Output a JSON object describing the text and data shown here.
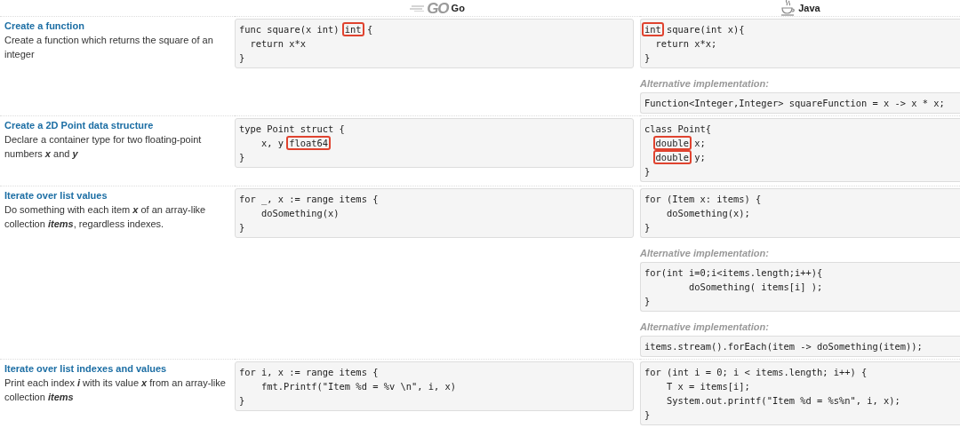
{
  "columns": [
    {
      "kind": "go",
      "logo_text": "GO",
      "label": "Go"
    },
    {
      "kind": "java",
      "label": "Java"
    }
  ],
  "rows": [
    {
      "title": "Create a function",
      "description": "Create a function which returns the square of an integer",
      "go": [
        {
          "lines": [
            [
              {
                "text": "func square(x int) ",
                "highlight": false
              },
              {
                "text": "int",
                "highlight": true
              },
              {
                "text": " {",
                "highlight": false
              }
            ],
            [
              {
                "text": "  return x*x",
                "highlight": false
              }
            ],
            [
              {
                "text": "}",
                "highlight": false
              }
            ]
          ]
        }
      ],
      "java": [
        {
          "lines": [
            [
              {
                "text": "int",
                "highlight": true
              },
              {
                "text": " square(int x){",
                "highlight": false
              }
            ],
            [
              {
                "text": "  return x*x;",
                "highlight": false
              }
            ],
            [
              {
                "text": "}",
                "highlight": false
              }
            ]
          ]
        },
        {
          "alt_label": "Alternative implementation:",
          "lines": [
            [
              {
                "text": "Function<Integer,Integer> squareFunction = x -> x * x;",
                "highlight": false
              }
            ]
          ]
        }
      ]
    },
    {
      "title": "Create a 2D Point data structure",
      "description": "Declare a container type for two floating-point numbers **x** and **y**",
      "go": [
        {
          "lines": [
            [
              {
                "text": "type Point struct {",
                "highlight": false
              }
            ],
            [
              {
                "text": "    x, y ",
                "highlight": false
              },
              {
                "text": "float64",
                "highlight": true
              }
            ],
            [
              {
                "text": "}",
                "highlight": false
              }
            ]
          ]
        }
      ],
      "java": [
        {
          "lines": [
            [
              {
                "text": "class Point{",
                "highlight": false
              }
            ],
            {
              "indented": true,
              "segments": [
                {
                  "text": "double",
                  "highlight": true
                },
                {
                  "text": " x;",
                  "highlight": false
                }
              ]
            },
            {
              "indented": true,
              "segments": [
                {
                  "text": "double",
                  "highlight": true
                },
                {
                  "text": " y;",
                  "highlight": false
                }
              ]
            },
            [
              {
                "text": "}",
                "highlight": false
              }
            ]
          ]
        }
      ]
    },
    {
      "title": "Iterate over list values",
      "description": "Do something with each item **x** of an array-like collection **items**, regardless indexes.",
      "go": [
        {
          "lines": [
            [
              {
                "text": "for _, x := range items {",
                "highlight": false
              }
            ],
            [
              {
                "text": "    doSomething(x)",
                "highlight": false
              }
            ],
            [
              {
                "text": "}",
                "highlight": false
              }
            ]
          ]
        }
      ],
      "java": [
        {
          "lines": [
            [
              {
                "text": "for (Item x: items) {",
                "highlight": false
              }
            ],
            [
              {
                "text": "    doSomething(x);",
                "highlight": false
              }
            ],
            [
              {
                "text": "}",
                "highlight": false
              }
            ]
          ]
        },
        {
          "alt_label": "Alternative implementation:",
          "lines": [
            [
              {
                "text": "for(int i=0;i<items.length;i++){",
                "highlight": false
              }
            ],
            [
              {
                "text": "        doSomething( items[i] );",
                "highlight": false
              }
            ],
            [
              {
                "text": "}",
                "highlight": false
              }
            ]
          ]
        },
        {
          "alt_label": "Alternative implementation:",
          "lines": [
            [
              {
                "text": "items.stream().forEach(item -> doSomething(item));",
                "highlight": false
              }
            ]
          ]
        }
      ]
    },
    {
      "title": "Iterate over list indexes and values",
      "description": "Print each index **i** with its value **x** from an array-like collection **items**",
      "go": [
        {
          "lines": [
            [
              {
                "text": "for i, x := range items {",
                "highlight": false
              }
            ],
            [
              {
                "text": "    fmt.Printf(\"Item %d = %v \\n\", i, x)",
                "highlight": false
              }
            ],
            [
              {
                "text": "}",
                "highlight": false
              }
            ]
          ]
        }
      ],
      "java": [
        {
          "lines": [
            [
              {
                "text": "for (int i = 0; i < items.length; i++) {",
                "highlight": false
              }
            ],
            [
              {
                "text": "    T x = items[i];",
                "highlight": false
              }
            ],
            [
              {
                "text": "    System.out.printf(\"Item %d = %s%n\", i, x);",
                "highlight": false
              }
            ],
            [
              {
                "text": "}",
                "highlight": false
              }
            ]
          ]
        }
      ]
    }
  ]
}
